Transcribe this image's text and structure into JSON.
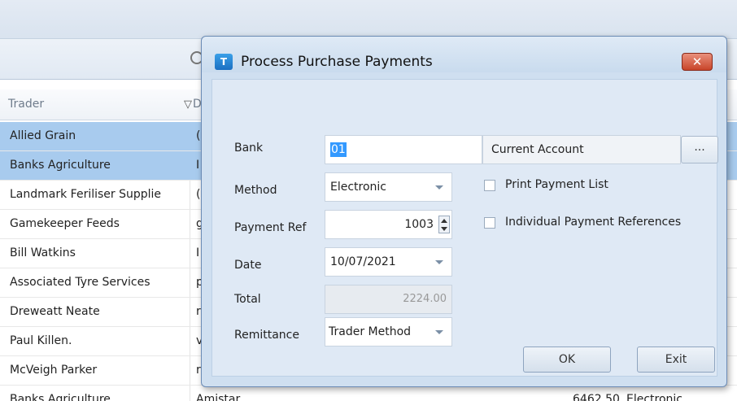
{
  "background": {
    "grid": {
      "columns": {
        "trader": "Trader",
        "d": "D"
      },
      "rows": [
        {
          "trader": "Allied Grain",
          "d": "(",
          "selected": true
        },
        {
          "trader": "Banks Agriculture",
          "d": "I",
          "selected": true
        },
        {
          "trader": "Landmark Feriliser Supplie",
          "d": "(",
          "selected": false
        },
        {
          "trader": "Gamekeeper Feeds",
          "d": "g",
          "selected": false
        },
        {
          "trader": "Bill Watkins",
          "d": "I",
          "selected": false
        },
        {
          "trader": "Associated Tyre Services",
          "d": "p",
          "selected": false
        },
        {
          "trader": "Dreweatt Neate",
          "d": "r",
          "selected": false
        },
        {
          "trader": "Paul Killen.",
          "d": "v",
          "selected": false
        },
        {
          "trader": "McVeigh Parker",
          "d": "r",
          "selected": false
        },
        {
          "trader": "Banks Agriculture",
          "d": "Amistar",
          "amount": "6462.50",
          "method": "Electronic",
          "selected": false
        }
      ]
    },
    "icons": {
      "search": "search-icon",
      "filter": "filter-icon"
    }
  },
  "dialog": {
    "title": "Process Purchase Payments",
    "close_label": "✕",
    "bank": {
      "label": "Bank",
      "code": "01",
      "name": "Current Account",
      "browse_label": "..."
    },
    "method": {
      "label": "Method",
      "value": "Electronic"
    },
    "payment_ref": {
      "label": "Payment Ref",
      "value": "1003"
    },
    "date": {
      "label": "Date",
      "value": "10/07/2021"
    },
    "total": {
      "label": "Total",
      "value": "2224.00"
    },
    "remittance": {
      "label": "Remittance",
      "value": "Trader Method"
    },
    "print_payment_list": {
      "label": "Print Payment List",
      "checked": false
    },
    "individual_refs": {
      "label": "Individual Payment References",
      "checked": false
    },
    "ok_label": "OK",
    "exit_label": "Exit"
  },
  "colors": {
    "selection": "#a8cbee",
    "dialog_body": "#dfe9f5",
    "close_button": "#c8452a"
  }
}
